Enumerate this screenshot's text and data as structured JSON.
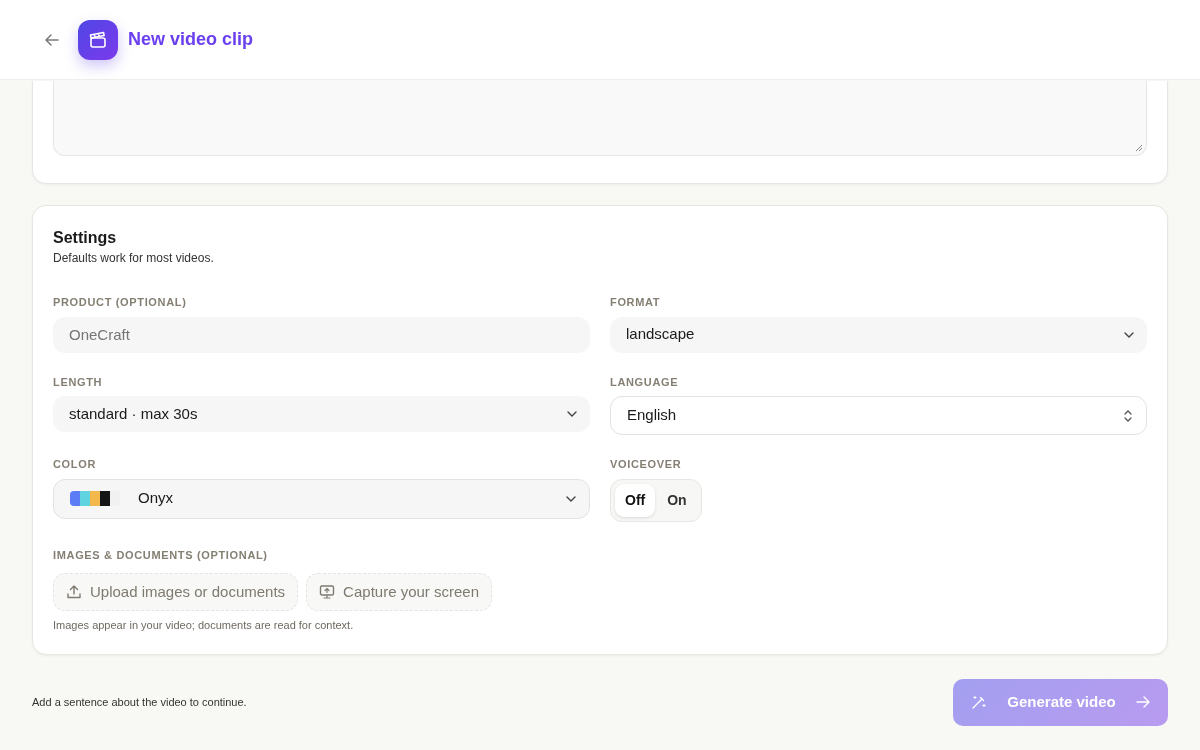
{
  "header": {
    "title": "New video clip"
  },
  "settings": {
    "title": "Settings",
    "subtitle": "Defaults work for most videos.",
    "fields": [
      {
        "kind": "input",
        "label": "PRODUCT (OPTIONAL)",
        "placeholder": "OneCraft"
      },
      {
        "kind": "select",
        "label": "FORMAT",
        "value": "landscape"
      },
      {
        "kind": "select",
        "label": "LENGTH",
        "value": "standard · max 30s"
      },
      {
        "kind": "stepper",
        "label": "LANGUAGE",
        "value": "English"
      },
      {
        "kind": "palette",
        "label": "COLOR",
        "value": "Onyx"
      },
      {
        "kind": "toggle",
        "label": "VOICEOVER",
        "options": [
          {
            "label": "Off",
            "selected": true
          },
          {
            "label": "On",
            "selected": false
          }
        ]
      }
    ],
    "uploads": {
      "label": "IMAGES & DOCUMENTS (OPTIONAL)",
      "buttons": [
        {
          "kind": "upload",
          "label": "Upload images or documents"
        },
        {
          "kind": "screen",
          "label": "Capture your screen"
        }
      ],
      "hint": "Images appear in your video; documents are read for context."
    }
  },
  "footer": {
    "hint": "Add a sentence about the video to continue.",
    "button": {
      "label": "Generate video",
      "disabled": true
    }
  }
}
